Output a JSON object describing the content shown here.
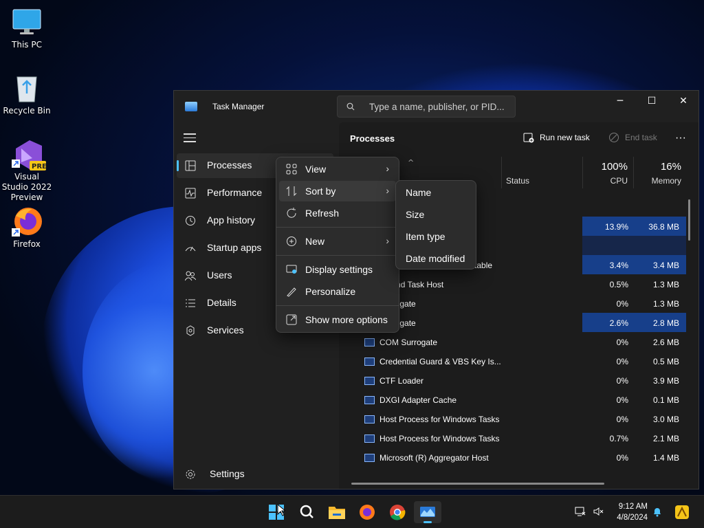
{
  "desktop": {
    "icons": [
      {
        "label": "This PC"
      },
      {
        "label": "Recycle Bin"
      },
      {
        "label": "Visual Studio 2022 Preview",
        "badge": "PRE"
      },
      {
        "label": "Firefox"
      }
    ]
  },
  "window": {
    "title": "Task Manager",
    "search_placeholder": "Type a name, publisher, or PID...",
    "controls": {
      "minimize": "─",
      "maximize": "☐",
      "close": "✕"
    }
  },
  "sidebar": {
    "items": [
      {
        "label": "Processes",
        "icon": "processes-icon",
        "selected": true
      },
      {
        "label": "Performance",
        "icon": "performance-icon"
      },
      {
        "label": "App history",
        "icon": "history-icon"
      },
      {
        "label": "Startup apps",
        "icon": "startup-icon"
      },
      {
        "label": "Users",
        "icon": "users-icon"
      },
      {
        "label": "Details",
        "icon": "details-icon"
      },
      {
        "label": "Services",
        "icon": "services-icon"
      }
    ],
    "settings": "Settings"
  },
  "content": {
    "title": "Processes",
    "run_new_task": "Run new task",
    "end_task": "End task",
    "columns": {
      "status": "Status",
      "cpu_pct": "100%",
      "cpu": "CPU",
      "mem_pct": "16%",
      "memory": "Memory"
    },
    "rows": [
      {
        "name": "",
        "cpu": "13.9%",
        "mem": "36.8 MB",
        "shade": "hl"
      },
      {
        "name": ")",
        "cpu": "",
        "mem": "",
        "shade": "lo"
      },
      {
        "name": "ntimalware Service Executable",
        "cpu": "3.4%",
        "mem": "3.4 MB",
        "shade": "hl"
      },
      {
        "name": "ground Task Host",
        "cpu": "0.5%",
        "mem": "1.3 MB",
        "shade": ""
      },
      {
        "name": "Surrogate",
        "cpu": "0%",
        "mem": "1.3 MB",
        "shade": ""
      },
      {
        "name": "Surrogate",
        "cpu": "2.6%",
        "mem": "2.8 MB",
        "shade": "hl"
      },
      {
        "name": "COM Surrogate",
        "cpu": "0%",
        "mem": "2.6 MB",
        "shade": ""
      },
      {
        "name": "Credential Guard & VBS Key Is...",
        "cpu": "0%",
        "mem": "0.5 MB",
        "shade": ""
      },
      {
        "name": "CTF Loader",
        "cpu": "0%",
        "mem": "3.9 MB",
        "shade": ""
      },
      {
        "name": "DXGI Adapter Cache",
        "cpu": "0%",
        "mem": "0.1 MB",
        "shade": ""
      },
      {
        "name": "Host Process for Windows Tasks",
        "cpu": "0%",
        "mem": "3.0 MB",
        "shade": ""
      },
      {
        "name": "Host Process for Windows Tasks",
        "cpu": "0.7%",
        "mem": "2.1 MB",
        "shade": ""
      },
      {
        "name": "Microsoft (R) Aggregator Host",
        "cpu": "0%",
        "mem": "1.4 MB",
        "shade": ""
      }
    ]
  },
  "context_menu": {
    "items": [
      {
        "label": "View",
        "icon": "view-icon",
        "submenu": true
      },
      {
        "label": "Sort by",
        "icon": "sort-icon",
        "submenu": true
      },
      {
        "label": "Refresh",
        "icon": "refresh-icon"
      },
      {
        "label": "New",
        "icon": "new-icon",
        "submenu": true
      },
      {
        "label": "Display settings",
        "icon": "display-icon"
      },
      {
        "label": "Personalize",
        "icon": "personalize-icon"
      },
      {
        "label": "Show more options",
        "icon": "more-options-icon"
      }
    ]
  },
  "sort_submenu": {
    "items": [
      "Name",
      "Size",
      "Item type",
      "Date modified"
    ]
  },
  "taskbar": {
    "time": "9:12 AM",
    "date": "4/8/2024",
    "apps": [
      "start",
      "search",
      "file-explorer",
      "firefox",
      "chrome",
      "task-manager"
    ],
    "accent": "#4cc2ff"
  }
}
